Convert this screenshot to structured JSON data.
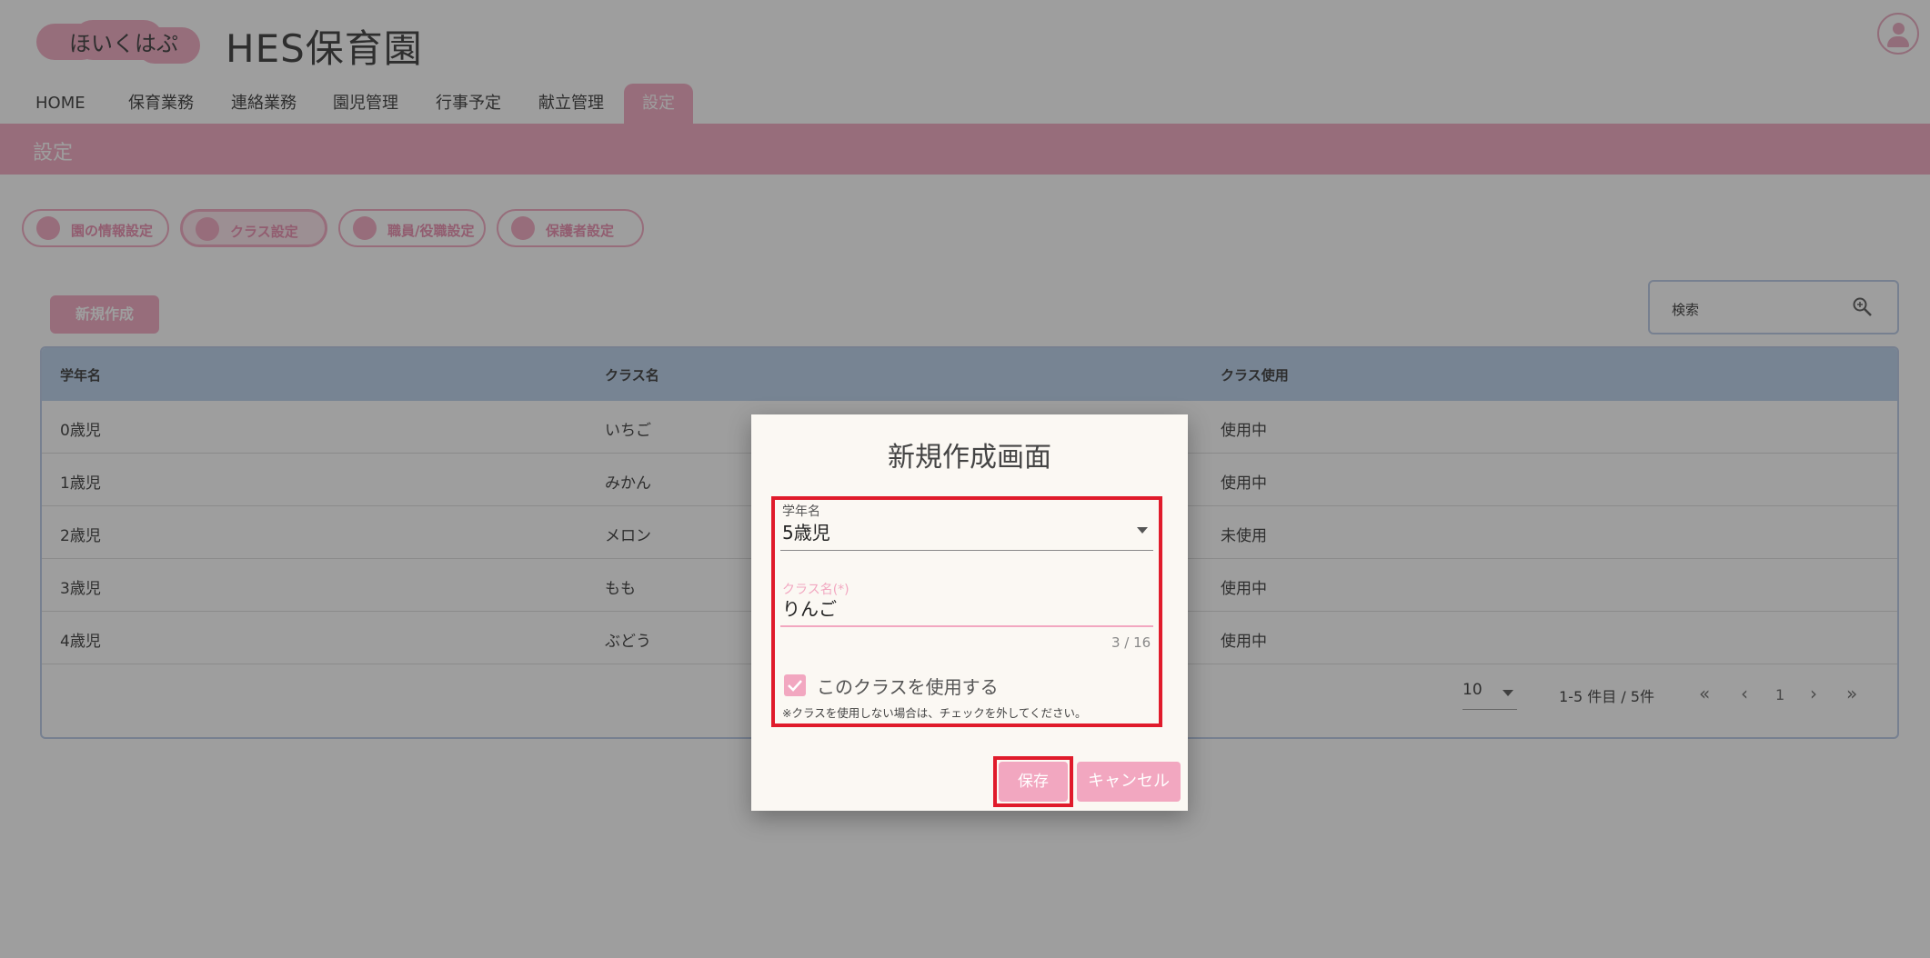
{
  "header": {
    "logo_text": "ほいくはぷ",
    "org_name": "HES保育園"
  },
  "nav": {
    "items": [
      {
        "label": "HOME"
      },
      {
        "label": "保育業務"
      },
      {
        "label": "連絡業務"
      },
      {
        "label": "園児管理"
      },
      {
        "label": "行事予定"
      },
      {
        "label": "献立管理"
      },
      {
        "label": "設定"
      }
    ],
    "active": "設定"
  },
  "section": {
    "title": "設定"
  },
  "settings_buttons": [
    {
      "label": "園の情報設定",
      "icon": "gear-icon"
    },
    {
      "label": "クラス設定",
      "icon": "child-icon"
    },
    {
      "label": "職員/役職設定",
      "icon": "staff-icon"
    },
    {
      "label": "保護者設定",
      "icon": "guardian-icon"
    }
  ],
  "toolbar": {
    "new_label": "新規作成",
    "search_placeholder": "検索"
  },
  "table": {
    "columns": [
      "学年名",
      "クラス名",
      "クラス使用"
    ],
    "rows": [
      [
        "0歳児",
        "いちご",
        "使用中"
      ],
      [
        "1歳児",
        "みかん",
        "使用中"
      ],
      [
        "2歳児",
        "メロン",
        "未使用"
      ],
      [
        "3歳児",
        "もも",
        "使用中"
      ],
      [
        "4歳児",
        "ぶどう",
        "使用中"
      ]
    ],
    "pager": {
      "per_page": "10",
      "info": "1-5 件目 / 5件",
      "current_page": "1"
    }
  },
  "dialog": {
    "title": "新規作成画面",
    "grade_label": "学年名",
    "grade_value": "5歳児",
    "class_label": "クラス名(*)",
    "class_value": "りんご",
    "counter": "3 / 16",
    "checkbox_label": "このクラスを使用する",
    "checkbox_checked": true,
    "note": "※クラスを使用しない場合は、チェックを外してください。",
    "save_label": "保存",
    "cancel_label": "キャンセル"
  },
  "colors": {
    "accent": "#f2a7c0",
    "table_header": "#b8d0ec",
    "highlight": "#e01b2b"
  }
}
